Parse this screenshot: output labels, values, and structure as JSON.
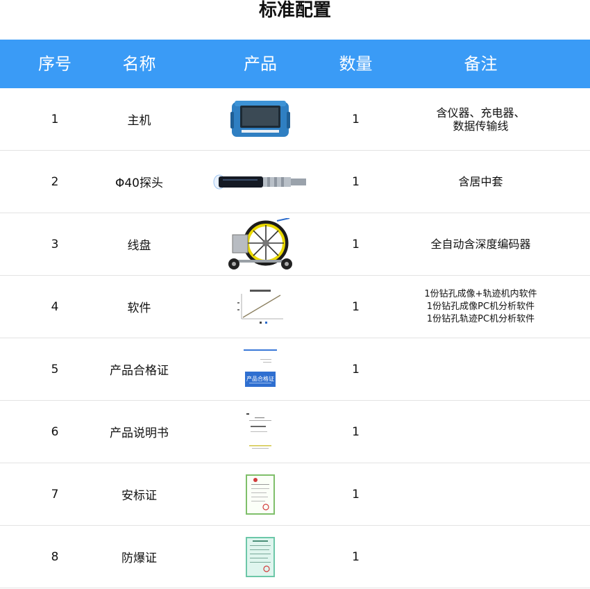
{
  "page_title": "标准配置",
  "table": {
    "headers": {
      "seq": "序号",
      "name": "名称",
      "product": "产品",
      "qty": "数量",
      "note": "备注"
    },
    "rows": [
      {
        "seq": "1",
        "name": "主机",
        "qty": "1",
        "note": [
          "含仪器、充电器、",
          "数据传输线"
        ],
        "product_icon": "host-device-icon"
      },
      {
        "seq": "2",
        "name": "Φ40探头",
        "qty": "1",
        "note": [
          "含居中套"
        ],
        "product_icon": "probe-icon"
      },
      {
        "seq": "3",
        "name": "线盘",
        "qty": "1",
        "note": [
          "全自动含深度编码器"
        ],
        "product_icon": "cable-reel-icon"
      },
      {
        "seq": "4",
        "name": "软件",
        "qty": "1",
        "note": [
          "1份钻孔成像+轨迹机内软件",
          "1份钻孔成像PC机分析软件",
          "1份钻孔轨迹PC机分析软件"
        ],
        "product_icon": "software-chart-icon"
      },
      {
        "seq": "5",
        "name": "产品合格证",
        "qty": "1",
        "note": [],
        "product_icon": "certificate-icon",
        "product_text": "产品合格证"
      },
      {
        "seq": "6",
        "name": "产品说明书",
        "qty": "1",
        "note": [],
        "product_icon": "manual-icon"
      },
      {
        "seq": "7",
        "name": "安标证",
        "qty": "1",
        "note": [],
        "product_icon": "safety-cert-icon"
      },
      {
        "seq": "8",
        "name": "防爆证",
        "qty": "1",
        "note": [],
        "product_icon": "explosion-proof-cert-icon"
      }
    ]
  },
  "colors": {
    "header_bg": "#3a9bf6",
    "header_text": "#ffffff",
    "row_divider": "#e3e3e3"
  }
}
